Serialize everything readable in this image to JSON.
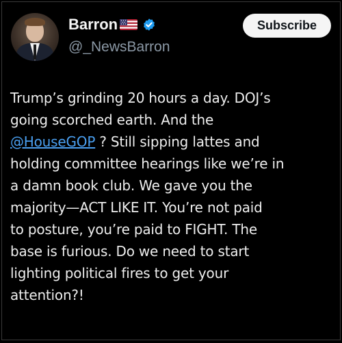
{
  "post": {
    "author": {
      "display_name": "Barron",
      "handle": "@_NewsBarron",
      "flag_icon": "us-flag-icon",
      "verified_icon": "verified-badge-icon",
      "verified_color": "#1d9bf0"
    },
    "subscribe_label": "Subscribe",
    "body_lines": [
      {
        "text": "Trump’s grinding 20 hours a day. DOJ’s"
      },
      {
        "text": "going scorched earth. And the"
      },
      {
        "mention": "@HouseGOP",
        "text": " ? Still sipping lattes and"
      },
      {
        "text": "holding committee hearings like we’re in"
      },
      {
        "text": "a damn book club. We gave you the"
      },
      {
        "text": "majority—ACT LIKE IT. You’re not paid"
      },
      {
        "text": "to posture, you’re paid to FIGHT. The"
      },
      {
        "text": "base is furious. Do we need to start"
      },
      {
        "text": "lighting political fires to get your"
      },
      {
        "text": "attention?!"
      }
    ]
  },
  "colors": {
    "background": "#000000",
    "text": "#eeeeee",
    "handle": "#8b98a5",
    "mention": "#4a9ff0",
    "button_bg": "#f5f5f5",
    "button_text": "#0f1419"
  }
}
